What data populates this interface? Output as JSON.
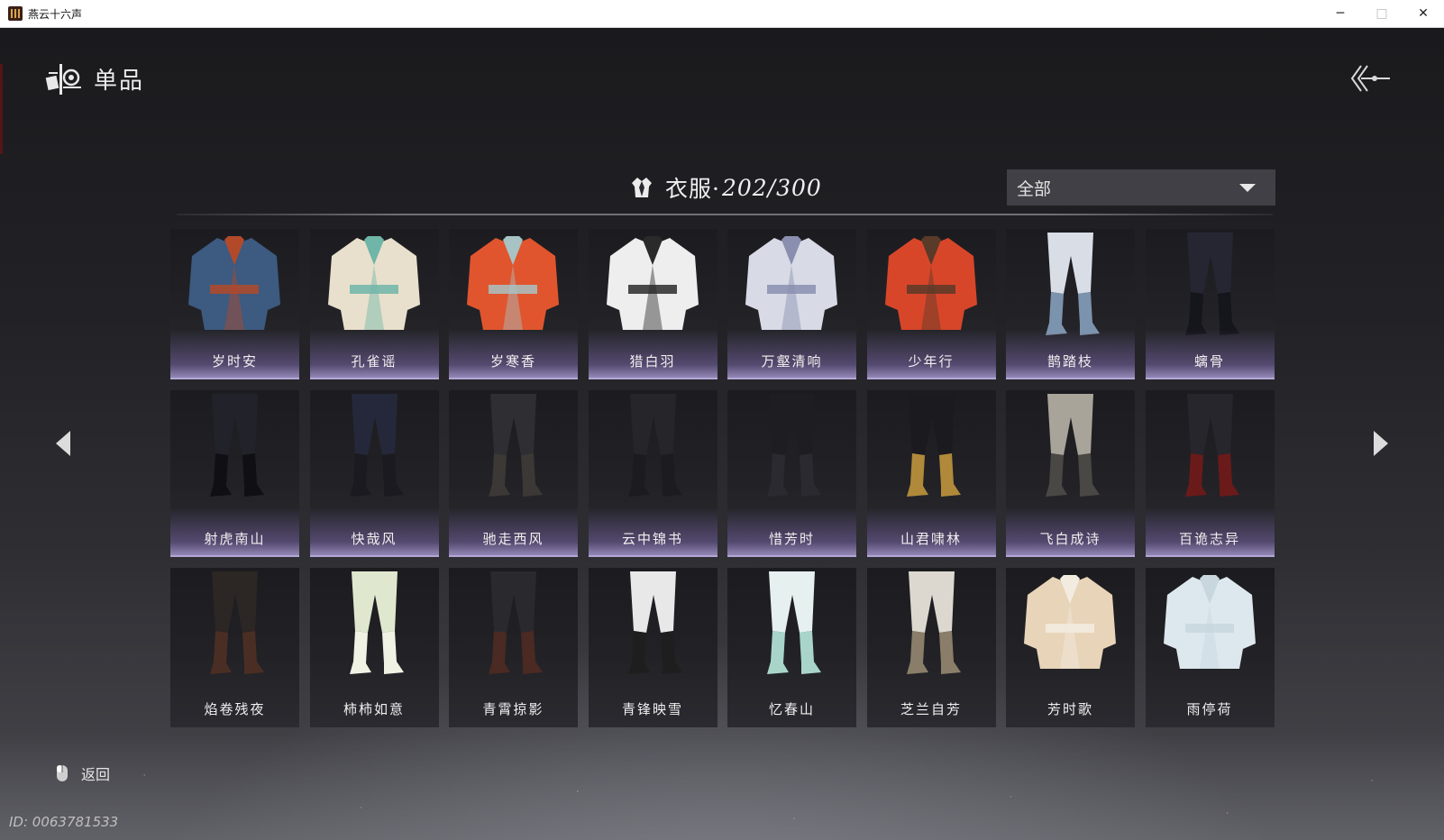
{
  "window": {
    "title": "燕云十六声",
    "controls": {
      "minimize": "─",
      "maximize": "□",
      "close": "✕"
    }
  },
  "header": {
    "title": "单品",
    "icon": "wardrobe-items-icon",
    "back_icon": "back-arrow-icon"
  },
  "category": {
    "label": "衣服·",
    "count": "202/300",
    "icon": "robe-icon"
  },
  "filter": {
    "selected": "全部"
  },
  "items": [
    {
      "name": "岁时安",
      "type": "outfit",
      "colors": [
        "#3d5a80",
        "#b24a2a"
      ],
      "highlight": true
    },
    {
      "name": "孔雀谣",
      "type": "outfit",
      "colors": [
        "#e8e0cc",
        "#6fb5a8"
      ],
      "highlight": true
    },
    {
      "name": "岁寒香",
      "type": "outfit",
      "colors": [
        "#e0552e",
        "#a8c3c4"
      ],
      "highlight": true
    },
    {
      "name": "猎白羽",
      "type": "outfit",
      "colors": [
        "#eeeeee",
        "#2a2a2a"
      ],
      "highlight": true
    },
    {
      "name": "万壑清响",
      "type": "outfit",
      "colors": [
        "#d8dbe6",
        "#8a8fb0"
      ],
      "highlight": true
    },
    {
      "name": "少年行",
      "type": "outfit",
      "colors": [
        "#d8462a",
        "#5a3a28"
      ],
      "highlight": true
    },
    {
      "name": "鹊踏枝",
      "type": "pants",
      "colors": [
        "#d8dde6",
        "#7c93ad"
      ],
      "highlight": true
    },
    {
      "name": "螭骨",
      "type": "pants",
      "colors": [
        "#262633",
        "#15151c"
      ],
      "highlight": true
    },
    {
      "name": "射虎南山",
      "type": "pants",
      "colors": [
        "#22222a",
        "#0f0f14"
      ],
      "highlight": true
    },
    {
      "name": "快哉风",
      "type": "pants",
      "colors": [
        "#25283a",
        "#1a1a20"
      ],
      "highlight": true
    },
    {
      "name": "驰走西风",
      "type": "pants",
      "colors": [
        "#2e2e33",
        "#3b3836"
      ],
      "highlight": true
    },
    {
      "name": "云中锦书",
      "type": "pants",
      "colors": [
        "#26262a",
        "#1c1c20"
      ],
      "highlight": true
    },
    {
      "name": "惜芳时",
      "type": "pants",
      "colors": [
        "#1d1d22",
        "#2a2a30"
      ],
      "highlight": true
    },
    {
      "name": "山君啸林",
      "type": "pants",
      "colors": [
        "#1a1a1f",
        "#b08a3a"
      ],
      "highlight": true
    },
    {
      "name": "飞白成诗",
      "type": "pants",
      "colors": [
        "#a9a49a",
        "#4a4844"
      ],
      "highlight": true
    },
    {
      "name": "百诡志异",
      "type": "pants",
      "colors": [
        "#26262c",
        "#6b1a1a"
      ],
      "highlight": true
    },
    {
      "name": "焰卷残夜",
      "type": "pants",
      "colors": [
        "#2c2624",
        "#4a2e24"
      ],
      "highlight": false
    },
    {
      "name": "柿柿如意",
      "type": "pants",
      "colors": [
        "#dfe8cf",
        "#f0f3e4"
      ],
      "highlight": false
    },
    {
      "name": "青霄掠影",
      "type": "pants",
      "colors": [
        "#2a2a2e",
        "#4a2a22"
      ],
      "highlight": false
    },
    {
      "name": "青锋映雪",
      "type": "pants",
      "colors": [
        "#e8e8e8",
        "#1e1e1e"
      ],
      "highlight": false
    },
    {
      "name": "忆春山",
      "type": "pants",
      "colors": [
        "#e6f0ee",
        "#a9d5c9"
      ],
      "highlight": false
    },
    {
      "name": "芝兰自芳",
      "type": "pants",
      "colors": [
        "#dcd8d0",
        "#8a7e6a"
      ],
      "highlight": false
    },
    {
      "name": "芳时歌",
      "type": "outfit",
      "colors": [
        "#e8d4b8",
        "#f2ece0"
      ],
      "highlight": false
    },
    {
      "name": "雨停荷",
      "type": "outfit",
      "colors": [
        "#dde8ee",
        "#c8d6de"
      ],
      "highlight": false
    }
  ],
  "nav": {
    "prev_icon": "chevron-left-icon",
    "next_icon": "chevron-right-icon"
  },
  "footer": {
    "back_label": "返回",
    "mouse_icon": "mouse-icon",
    "player_id": "ID: 0063781533"
  }
}
